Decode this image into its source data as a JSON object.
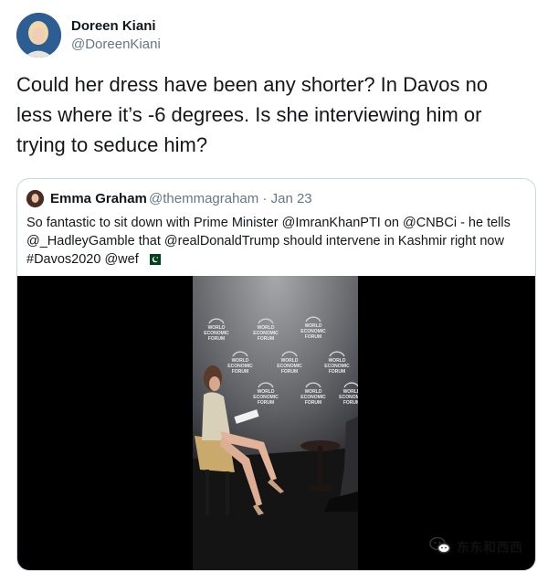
{
  "tweet": {
    "name": "Doreen Kiani",
    "handle": "@DoreenKiani",
    "text": "Could her dress have been any shorter? In Davos no less where it’s -6 degrees. Is she interviewing him or trying to seduce him?"
  },
  "quoted": {
    "name": "Emma Graham",
    "meta": "@themmagraham · Jan 23",
    "text": "So fantastic to sit down with Prime Minister @ImranKhanPTI on @CNBCi - he tells @_HadleyGamble that @realDonaldTrump should intervene in Kashmir right now #Davos2020 @wef",
    "flag_icon": "pakistan-flag-icon"
  },
  "video": {
    "backdrop_logo_lines": [
      "WORLD",
      "ECONOMIC",
      "FORUM"
    ]
  },
  "watermark": {
    "text": "东东和西西",
    "icon": "wechat-icon"
  }
}
